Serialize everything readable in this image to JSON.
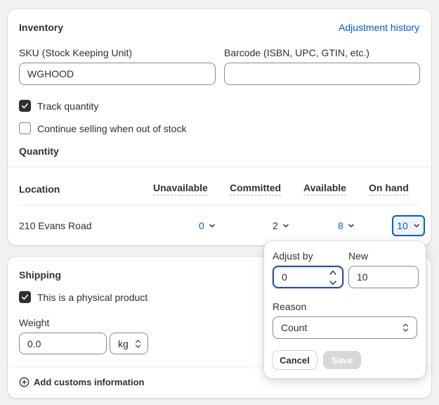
{
  "inventory": {
    "title": "Inventory",
    "history_link": "Adjustment history",
    "sku_label": "SKU (Stock Keeping Unit)",
    "sku_value": "WGHOOD",
    "barcode_label": "Barcode (ISBN, UPC, GTIN, etc.)",
    "barcode_value": "",
    "track_quantity_label": "Track quantity",
    "track_quantity_checked": true,
    "continue_selling_label": "Continue selling when out of stock",
    "continue_selling_checked": false,
    "quantity_heading": "Quantity",
    "table": {
      "location_header": "Location",
      "columns": [
        "Unavailable",
        "Committed",
        "Available",
        "On hand"
      ],
      "rows": [
        {
          "location": "210 Evans Road",
          "unavailable": "0",
          "committed": "2",
          "available": "8",
          "on_hand": "10"
        }
      ]
    }
  },
  "shipping": {
    "title": "Shipping",
    "physical_label": "This is a physical product",
    "physical_checked": true,
    "weight_label": "Weight",
    "weight_value": "0.0",
    "weight_unit": "kg",
    "customs_link": "Add customs information"
  },
  "adjust_popover": {
    "adjust_by_label": "Adjust by",
    "adjust_by_value": "0",
    "new_label": "New",
    "new_value": "10",
    "reason_label": "Reason",
    "reason_value": "Count",
    "cancel_label": "Cancel",
    "save_label": "Save"
  },
  "colors": {
    "accent": "#005bd3",
    "focus": "#2c4fa8",
    "checkbox_checked": "#303030",
    "disabled_button": "#d8d8d8"
  },
  "icons": [
    "checkmark-icon",
    "chevron-down-icon",
    "stepper-icon",
    "select-chevron-icon",
    "plus-circle-icon"
  ]
}
